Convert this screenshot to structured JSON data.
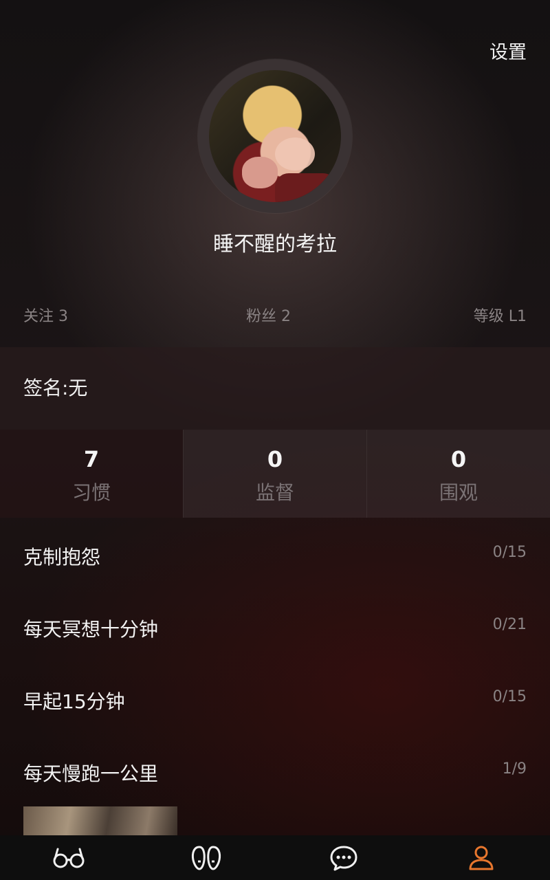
{
  "header": {
    "settings_label": "设置",
    "username": "睡不醒的考拉",
    "stats": {
      "following": "关注 3",
      "fans": "粉丝  2",
      "level": "等级 L1"
    }
  },
  "signature": "签名:无",
  "tabs": [
    {
      "count": "7",
      "label": "习惯"
    },
    {
      "count": "0",
      "label": "监督"
    },
    {
      "count": "0",
      "label": "围观"
    }
  ],
  "habits": [
    {
      "name": "克制抱怨",
      "progress": "0/15"
    },
    {
      "name": "每天冥想十分钟",
      "progress": "0/21"
    },
    {
      "name": "早起15分钟",
      "progress": "0/15"
    },
    {
      "name": "每天慢跑一公里",
      "progress": "1/9"
    }
  ],
  "navbar": {
    "icons": [
      "glasses-icon",
      "footprints-icon",
      "chat-bubble-icon",
      "person-icon"
    ],
    "active_color": "#e8772e",
    "inactive_color": "#f0f0f0"
  }
}
